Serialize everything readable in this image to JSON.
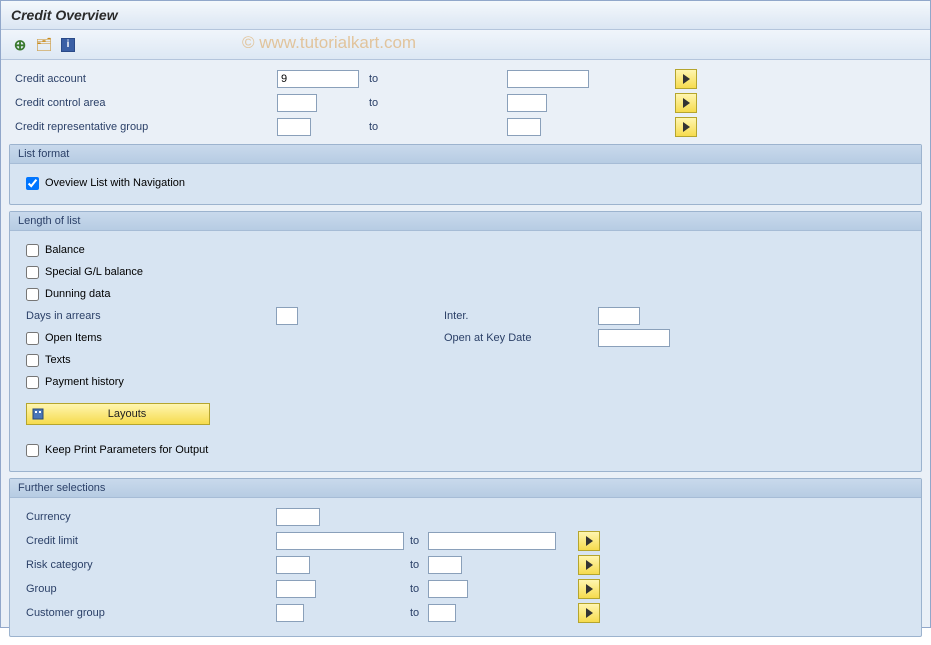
{
  "title": "Credit Overview",
  "watermark": "© www.tutorialkart.com",
  "toolbar": {
    "execute_tip": "Execute",
    "variant_tip": "Get Variant",
    "info_tip": "Information",
    "info_glyph": "i"
  },
  "selection": {
    "credit_account": {
      "label": "Credit account",
      "from": "9",
      "to_label": "to",
      "to": ""
    },
    "credit_control_area": {
      "label": "Credit control area",
      "from": "",
      "to_label": "to",
      "to": ""
    },
    "credit_rep_group": {
      "label": "Credit representative group",
      "from": "",
      "to_label": "to",
      "to": ""
    }
  },
  "list_format": {
    "title": "List format",
    "overview_nav": {
      "label": "Oveview List with Navigation",
      "checked": true
    }
  },
  "length_of_list": {
    "title": "Length of list",
    "balance": {
      "label": "Balance",
      "checked": false
    },
    "special_gl": {
      "label": "Special G/L balance",
      "checked": false
    },
    "dunning": {
      "label": "Dunning data",
      "checked": false
    },
    "days_in_arrears": {
      "label": "Days in arrears",
      "value": ""
    },
    "inter": {
      "label": "Inter.",
      "value": ""
    },
    "open_items": {
      "label": "Open Items",
      "checked": false
    },
    "open_at_key_date": {
      "label": "Open at Key Date",
      "value": ""
    },
    "texts": {
      "label": "Texts",
      "checked": false
    },
    "payment_history": {
      "label": "Payment history",
      "checked": false
    },
    "layouts_btn": "Layouts",
    "keep_print": {
      "label": "Keep Print Parameters for Output",
      "checked": false
    }
  },
  "further_selections": {
    "title": "Further selections",
    "currency": {
      "label": "Currency",
      "value": ""
    },
    "credit_limit": {
      "label": "Credit limit",
      "from": "",
      "to_label": "to",
      "to": ""
    },
    "risk_category": {
      "label": "Risk category",
      "from": "",
      "to_label": "to",
      "to": ""
    },
    "group": {
      "label": "Group",
      "from": "",
      "to_label": "to",
      "to": ""
    },
    "customer_group": {
      "label": "Customer group",
      "from": "",
      "to_label": "to",
      "to": ""
    }
  }
}
